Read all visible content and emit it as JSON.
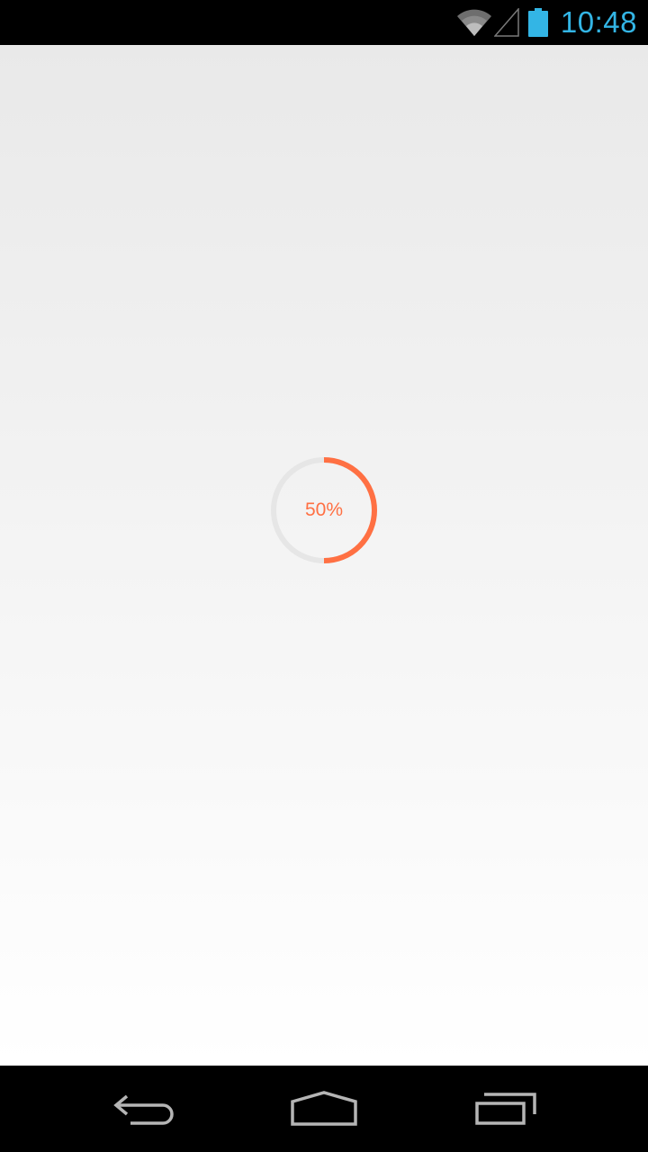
{
  "status_bar": {
    "time": "10:48",
    "icons": [
      "wifi-icon",
      "cell-signal-icon",
      "battery-icon"
    ],
    "clock_color": "#33b5e5",
    "battery_color": "#33b5e5"
  },
  "progress": {
    "label": "50%",
    "fraction": 0.5,
    "accent_color": "#ff7043",
    "track_color": "#e6e6e6"
  },
  "nav_bar": {
    "buttons": [
      "back-icon",
      "home-icon",
      "recents-icon"
    ]
  }
}
